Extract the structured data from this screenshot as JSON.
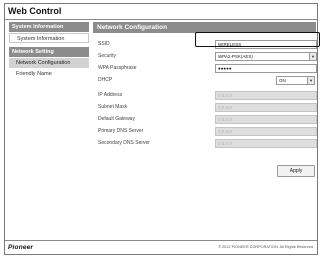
{
  "app_title": "Web Control",
  "sidebar": {
    "sections": [
      {
        "heading": "System Information",
        "items": [
          "System Information"
        ]
      },
      {
        "heading": "Network Setting",
        "items": [
          "Network Configuration",
          "Friendly Name"
        ]
      }
    ]
  },
  "main": {
    "title": "Network Configuration",
    "fields": [
      {
        "label": "SSID",
        "value": "WIRELESS",
        "type": "text"
      },
      {
        "label": "Security",
        "value": "WPA2-PSK(AES)",
        "type": "select"
      },
      {
        "label": "WPA Passphrase",
        "value": "●●●●●",
        "type": "password"
      },
      {
        "label": "DHCP",
        "value": "ON",
        "type": "select-short"
      },
      {
        "label": "IP Address",
        "value": "0.0.0.0",
        "type": "disabled"
      },
      {
        "label": "Subnet Mask",
        "value": "0.0.0.0",
        "type": "disabled"
      },
      {
        "label": "Default Gateway",
        "value": "0.0.0.0",
        "type": "disabled"
      },
      {
        "label": "Primary DNS Server",
        "value": "0.0.0.0",
        "type": "disabled"
      },
      {
        "label": "Secondary DNS Server",
        "value": "0.0.0.0",
        "type": "disabled"
      }
    ],
    "apply_label": "Apply"
  },
  "footer": {
    "logo": "Pioneer",
    "copyright": "© 2012 PIONEER CORPORATION. All Rights Reserved."
  },
  "colors": {
    "header_bg": "#8c8c8c",
    "active_item_bg": "#d2d2d2",
    "disabled_field_bg": "#dedede"
  }
}
